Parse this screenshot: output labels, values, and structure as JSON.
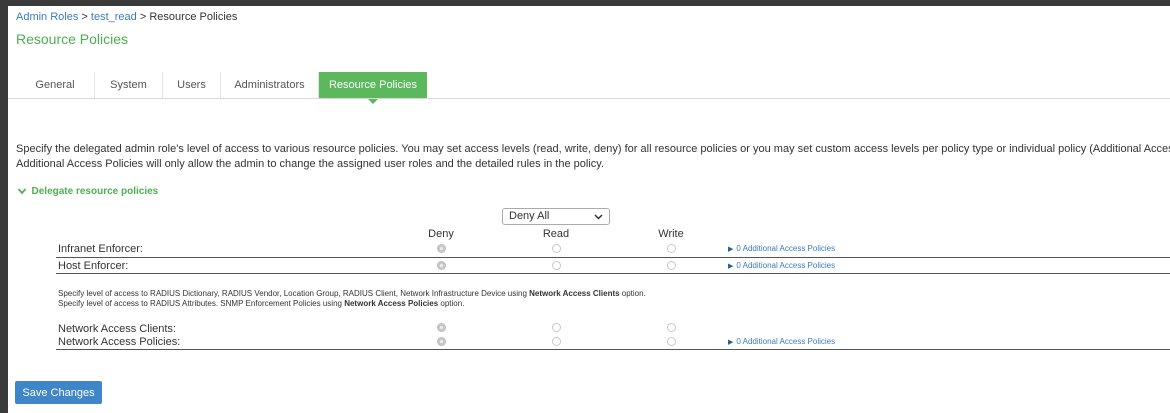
{
  "breadcrumb": {
    "items": [
      "Admin Roles",
      "test_read"
    ],
    "separator": ">",
    "current": "Resource Policies"
  },
  "page_title": "Resource Policies",
  "tabs": [
    "General",
    "System",
    "Users",
    "Administrators",
    "Resource Policies"
  ],
  "active_tab": "Resource Policies",
  "description": {
    "line1": "Specify the delegated admin role's level of access to various resource policies. You may set access levels (read, write, deny) for all resource policies or you may set custom access levels per policy type or individual policy (Additional Access Policies). The Write access for the",
    "line2": "Additional Access Policies will only allow the admin to change the assigned user roles and the detailed rules in the policy."
  },
  "section": {
    "title": "Delegate resource policies",
    "icon": "chevron-down-icon"
  },
  "select": {
    "value": "Deny All"
  },
  "columns": [
    "Deny",
    "Read",
    "Write"
  ],
  "rows1": [
    {
      "label": "Infranet Enforcer:",
      "selected": "Deny",
      "link": "0 Additional Access Policies"
    },
    {
      "label": "Host Enforcer:",
      "selected": "Deny",
      "link": "0 Additional Access Policies"
    }
  ],
  "notes": {
    "line1_prefix": "Specify level of access to RADIUS Dictionary, RADIUS Vendor, Location Group, RADIUS Client, Network Infrastructure Device using ",
    "line1_bold": "Network Access Clients",
    "line1_suffix": " option.",
    "line2_prefix": "Specify level of access to RADIUS Attributes. SNMP Enforcement Policies using ",
    "line2_bold": "Network Access Policies",
    "line2_suffix": " option."
  },
  "rows2": [
    {
      "label": "Network Access Clients:",
      "selected": "Deny",
      "link": ""
    },
    {
      "label": "Network Access Policies:",
      "selected": "Deny",
      "link": "0 Additional Access Policies"
    }
  ],
  "save_button": "Save Changes",
  "colors": {
    "accent_green": "#5cb85c",
    "title_green": "#4caf50",
    "link_blue": "#3a7bbf",
    "button_blue": "#3f86c8"
  }
}
